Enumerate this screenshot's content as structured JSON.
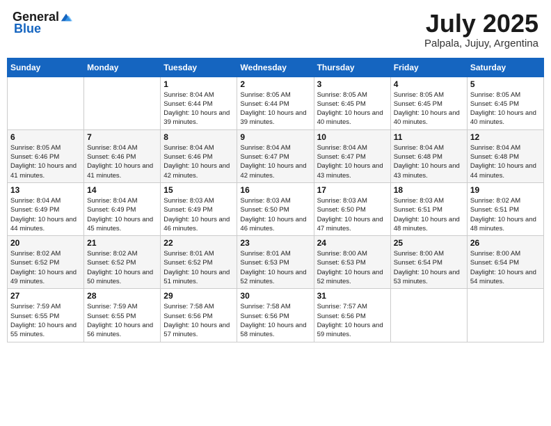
{
  "header": {
    "logo_general": "General",
    "logo_blue": "Blue",
    "month": "July 2025",
    "location": "Palpala, Jujuy, Argentina"
  },
  "days_of_week": [
    "Sunday",
    "Monday",
    "Tuesday",
    "Wednesday",
    "Thursday",
    "Friday",
    "Saturday"
  ],
  "weeks": [
    [
      {
        "day": "",
        "info": ""
      },
      {
        "day": "",
        "info": ""
      },
      {
        "day": "1",
        "info": "Sunrise: 8:04 AM\nSunset: 6:44 PM\nDaylight: 10 hours and 39 minutes."
      },
      {
        "day": "2",
        "info": "Sunrise: 8:05 AM\nSunset: 6:44 PM\nDaylight: 10 hours and 39 minutes."
      },
      {
        "day": "3",
        "info": "Sunrise: 8:05 AM\nSunset: 6:45 PM\nDaylight: 10 hours and 40 minutes."
      },
      {
        "day": "4",
        "info": "Sunrise: 8:05 AM\nSunset: 6:45 PM\nDaylight: 10 hours and 40 minutes."
      },
      {
        "day": "5",
        "info": "Sunrise: 8:05 AM\nSunset: 6:45 PM\nDaylight: 10 hours and 40 minutes."
      }
    ],
    [
      {
        "day": "6",
        "info": "Sunrise: 8:05 AM\nSunset: 6:46 PM\nDaylight: 10 hours and 41 minutes."
      },
      {
        "day": "7",
        "info": "Sunrise: 8:04 AM\nSunset: 6:46 PM\nDaylight: 10 hours and 41 minutes."
      },
      {
        "day": "8",
        "info": "Sunrise: 8:04 AM\nSunset: 6:46 PM\nDaylight: 10 hours and 42 minutes."
      },
      {
        "day": "9",
        "info": "Sunrise: 8:04 AM\nSunset: 6:47 PM\nDaylight: 10 hours and 42 minutes."
      },
      {
        "day": "10",
        "info": "Sunrise: 8:04 AM\nSunset: 6:47 PM\nDaylight: 10 hours and 43 minutes."
      },
      {
        "day": "11",
        "info": "Sunrise: 8:04 AM\nSunset: 6:48 PM\nDaylight: 10 hours and 43 minutes."
      },
      {
        "day": "12",
        "info": "Sunrise: 8:04 AM\nSunset: 6:48 PM\nDaylight: 10 hours and 44 minutes."
      }
    ],
    [
      {
        "day": "13",
        "info": "Sunrise: 8:04 AM\nSunset: 6:49 PM\nDaylight: 10 hours and 44 minutes."
      },
      {
        "day": "14",
        "info": "Sunrise: 8:04 AM\nSunset: 6:49 PM\nDaylight: 10 hours and 45 minutes."
      },
      {
        "day": "15",
        "info": "Sunrise: 8:03 AM\nSunset: 6:49 PM\nDaylight: 10 hours and 46 minutes."
      },
      {
        "day": "16",
        "info": "Sunrise: 8:03 AM\nSunset: 6:50 PM\nDaylight: 10 hours and 46 minutes."
      },
      {
        "day": "17",
        "info": "Sunrise: 8:03 AM\nSunset: 6:50 PM\nDaylight: 10 hours and 47 minutes."
      },
      {
        "day": "18",
        "info": "Sunrise: 8:03 AM\nSunset: 6:51 PM\nDaylight: 10 hours and 48 minutes."
      },
      {
        "day": "19",
        "info": "Sunrise: 8:02 AM\nSunset: 6:51 PM\nDaylight: 10 hours and 48 minutes."
      }
    ],
    [
      {
        "day": "20",
        "info": "Sunrise: 8:02 AM\nSunset: 6:52 PM\nDaylight: 10 hours and 49 minutes."
      },
      {
        "day": "21",
        "info": "Sunrise: 8:02 AM\nSunset: 6:52 PM\nDaylight: 10 hours and 50 minutes."
      },
      {
        "day": "22",
        "info": "Sunrise: 8:01 AM\nSunset: 6:52 PM\nDaylight: 10 hours and 51 minutes."
      },
      {
        "day": "23",
        "info": "Sunrise: 8:01 AM\nSunset: 6:53 PM\nDaylight: 10 hours and 52 minutes."
      },
      {
        "day": "24",
        "info": "Sunrise: 8:00 AM\nSunset: 6:53 PM\nDaylight: 10 hours and 52 minutes."
      },
      {
        "day": "25",
        "info": "Sunrise: 8:00 AM\nSunset: 6:54 PM\nDaylight: 10 hours and 53 minutes."
      },
      {
        "day": "26",
        "info": "Sunrise: 8:00 AM\nSunset: 6:54 PM\nDaylight: 10 hours and 54 minutes."
      }
    ],
    [
      {
        "day": "27",
        "info": "Sunrise: 7:59 AM\nSunset: 6:55 PM\nDaylight: 10 hours and 55 minutes."
      },
      {
        "day": "28",
        "info": "Sunrise: 7:59 AM\nSunset: 6:55 PM\nDaylight: 10 hours and 56 minutes."
      },
      {
        "day": "29",
        "info": "Sunrise: 7:58 AM\nSunset: 6:56 PM\nDaylight: 10 hours and 57 minutes."
      },
      {
        "day": "30",
        "info": "Sunrise: 7:58 AM\nSunset: 6:56 PM\nDaylight: 10 hours and 58 minutes."
      },
      {
        "day": "31",
        "info": "Sunrise: 7:57 AM\nSunset: 6:56 PM\nDaylight: 10 hours and 59 minutes."
      },
      {
        "day": "",
        "info": ""
      },
      {
        "day": "",
        "info": ""
      }
    ]
  ]
}
